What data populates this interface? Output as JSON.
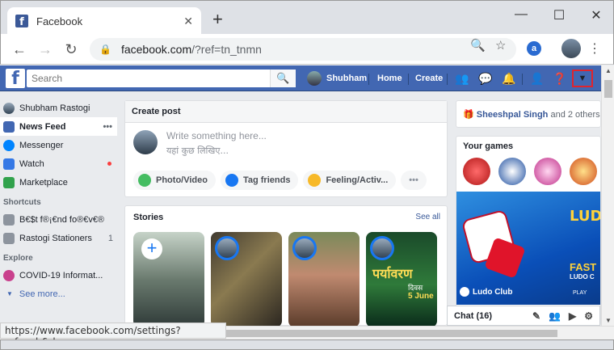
{
  "browser": {
    "tab_title": "Facebook",
    "url_host": "facebook.com",
    "url_rest": "/?ref=tn_tnmn",
    "status_url": "https://www.facebook.com/settings?ref=mb&drop"
  },
  "fb_header": {
    "search_placeholder": "Search",
    "user_name": "Shubham",
    "home_label": "Home",
    "create_label": "Create"
  },
  "left_nav": {
    "profile_name": "Shubham Rastogi",
    "items": [
      {
        "label": "News Feed"
      },
      {
        "label": "Messenger"
      },
      {
        "label": "Watch"
      },
      {
        "label": "Marketplace"
      }
    ],
    "shortcuts_title": "Shortcuts",
    "shortcuts": [
      {
        "label": "B€$t f®¡€nd fo®€v€®"
      },
      {
        "label": "Rastogi Stationers",
        "count": "1"
      }
    ],
    "explore_title": "Explore",
    "explore": [
      {
        "label": "COVID-19 Informat..."
      }
    ],
    "see_more": "See more..."
  },
  "create_post": {
    "title": "Create post",
    "placeholder_en": "Write something here...",
    "placeholder_hi": "यहां कुछ लिखिए...",
    "photo_video": "Photo/Video",
    "tag_friends": "Tag friends",
    "feeling": "Feeling/Activ...",
    "more": "•••"
  },
  "stories": {
    "title": "Stories",
    "see_all": "See all",
    "story3_text": "पर्यावरण",
    "story3_sub": "दिवस",
    "story3_date": "5 June"
  },
  "right_col": {
    "birthday_name": "Sheeshpal Singh",
    "birthday_rest": "and 2 others",
    "games_title": "Your games",
    "game_banner_title": "Ludo Club",
    "game_banner_big": "LUDO",
    "game_banner_fast": "FAST",
    "game_banner_sub": "LUDO C",
    "game_play": "PLAY"
  },
  "chat": {
    "label": "Chat (16)"
  }
}
